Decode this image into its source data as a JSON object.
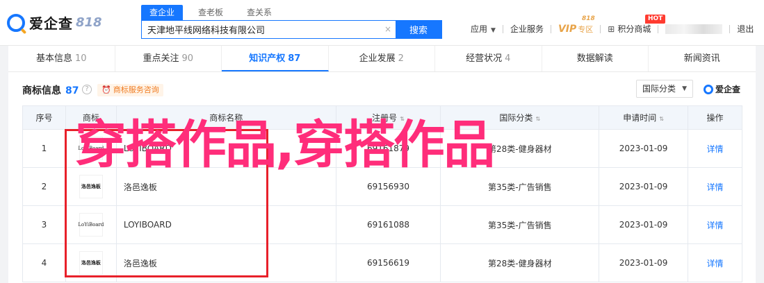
{
  "brand": {
    "name": "爱企查",
    "version": "818"
  },
  "search": {
    "tabs": [
      "查企业",
      "查老板",
      "查关系"
    ],
    "active_tab": 0,
    "value": "天津地平线网络科技有限公司",
    "button": "搜索"
  },
  "top_nav": {
    "apps": "应用",
    "services": "企业服务",
    "vip": "VIP",
    "vip_sub": "专区",
    "vip_badge": "818",
    "points": "积分商城",
    "hot": "HOT",
    "logout": "退出"
  },
  "tabs": [
    {
      "label": "基本信息",
      "count": "10"
    },
    {
      "label": "重点关注",
      "count": "90"
    },
    {
      "label": "知识产权",
      "count": "87"
    },
    {
      "label": "企业发展",
      "count": "2"
    },
    {
      "label": "经营状况",
      "count": "4"
    },
    {
      "label": "数据解读",
      "count": ""
    },
    {
      "label": "新闻资讯",
      "count": ""
    }
  ],
  "section": {
    "title": "商标信息",
    "count": "87",
    "consult": "商标服务咨询",
    "filter": "国际分类",
    "mini_logo": "爱企查"
  },
  "table": {
    "headers": [
      "序号",
      "商标",
      "商标名称",
      "注册号",
      "国际分类",
      "申请时间",
      "操作"
    ],
    "rows": [
      {
        "no": "1",
        "logo": "LoYiBoard",
        "name": "LOYIBOARD",
        "reg": "69161879",
        "cls": "第28类-健身器材",
        "date": "2023-01-09",
        "action": "详情"
      },
      {
        "no": "2",
        "logo": "洛邑逸板",
        "name": "洛邑逸板",
        "reg": "69156930",
        "cls": "第35类-广告销售",
        "date": "2023-01-09",
        "action": "详情"
      },
      {
        "no": "3",
        "logo": "LoYiBoard",
        "name": "LOYIBOARD",
        "reg": "69161088",
        "cls": "第35类-广告销售",
        "date": "2023-01-09",
        "action": "详情"
      },
      {
        "no": "4",
        "logo": "洛邑逸板",
        "name": "洛邑逸板",
        "reg": "69156619",
        "cls": "第28类-健身器材",
        "date": "2023-01-09",
        "action": "详情"
      }
    ]
  },
  "overlay": "穿搭作品,穿搭作品",
  "colors": {
    "accent": "#1677ff",
    "overlay": "#ff2d7a",
    "frame": "#e8202a"
  }
}
